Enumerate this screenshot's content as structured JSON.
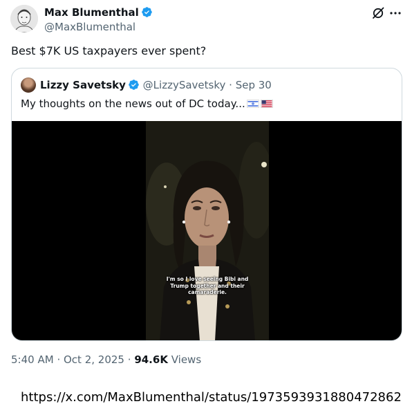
{
  "author": {
    "name": "Max Blumenthal",
    "handle": "@MaxBlumenthal",
    "avatar": "avatar-sketch-portrait",
    "verified_badge": "verified-icon"
  },
  "actions": {
    "grok_icon": "grok-icon",
    "more_icon": "more-icon"
  },
  "tweet": {
    "text": "Best $7K US taxpayers ever spent?"
  },
  "quoted": {
    "name": "Lizzy Savetsky",
    "handle": "@LizzySavetsky",
    "date": "Sep 30",
    "separator": "·",
    "text": "My thoughts on the news out of DC today...",
    "flags": [
      "israel-flag-icon",
      "us-flag-icon"
    ],
    "video_caption_lines": [
      "I'm so I love seeing Bibi and",
      "Trump together and their",
      "camaraderie."
    ]
  },
  "footer": {
    "time": "5:40 AM",
    "date": "Oct 2, 2025",
    "separator": "·",
    "views_count": "94.6K",
    "views_label": "Views"
  },
  "url": "https://x.com/MaxBlumenthal/status/1973593931880472862",
  "colors": {
    "text_primary": "#0f1419",
    "text_secondary": "#536471",
    "verified_blue": "#1d9bf0",
    "border": "#cfd9de"
  }
}
